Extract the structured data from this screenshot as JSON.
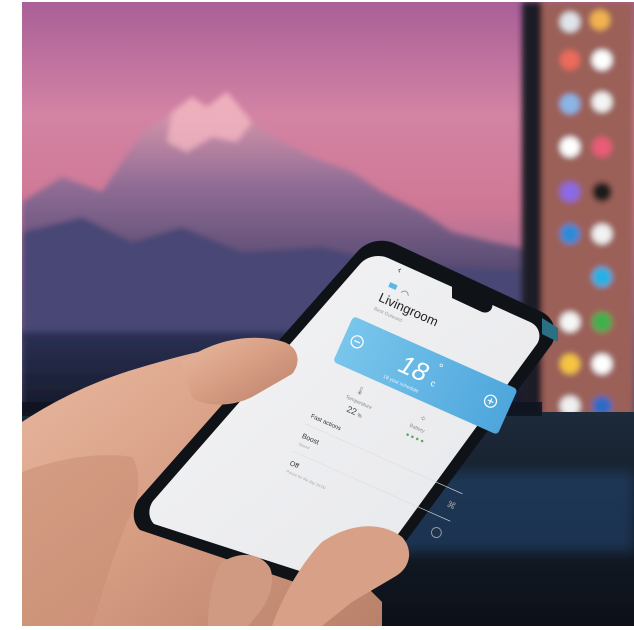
{
  "app": {
    "room_title": "Livingroom",
    "temperature": "18",
    "temperature_unit": "°",
    "temperature_suffix": "c",
    "section_fast_actions": "Fast actions",
    "humidity_value": "22",
    "humidity_suffix": "%",
    "action_boost_title": "Boost",
    "action_off_title": "Off"
  },
  "colors": {
    "sky_top": "#b06a9a",
    "sky_pink": "#d07fa0",
    "mountain_dark": "#3a3a68",
    "phone_accent_blue": "#5fb6e4",
    "phone_body": "#151a20"
  },
  "icons": {
    "back": "chevron-left-icon",
    "tag": "tag-icon",
    "wifi": "wifi-icon",
    "minus": "minus-circle-icon",
    "plus": "plus-circle-icon",
    "thermometer": "thermometer-icon",
    "battery": "battery-icon",
    "fan": "fan-icon",
    "power": "power-icon"
  }
}
